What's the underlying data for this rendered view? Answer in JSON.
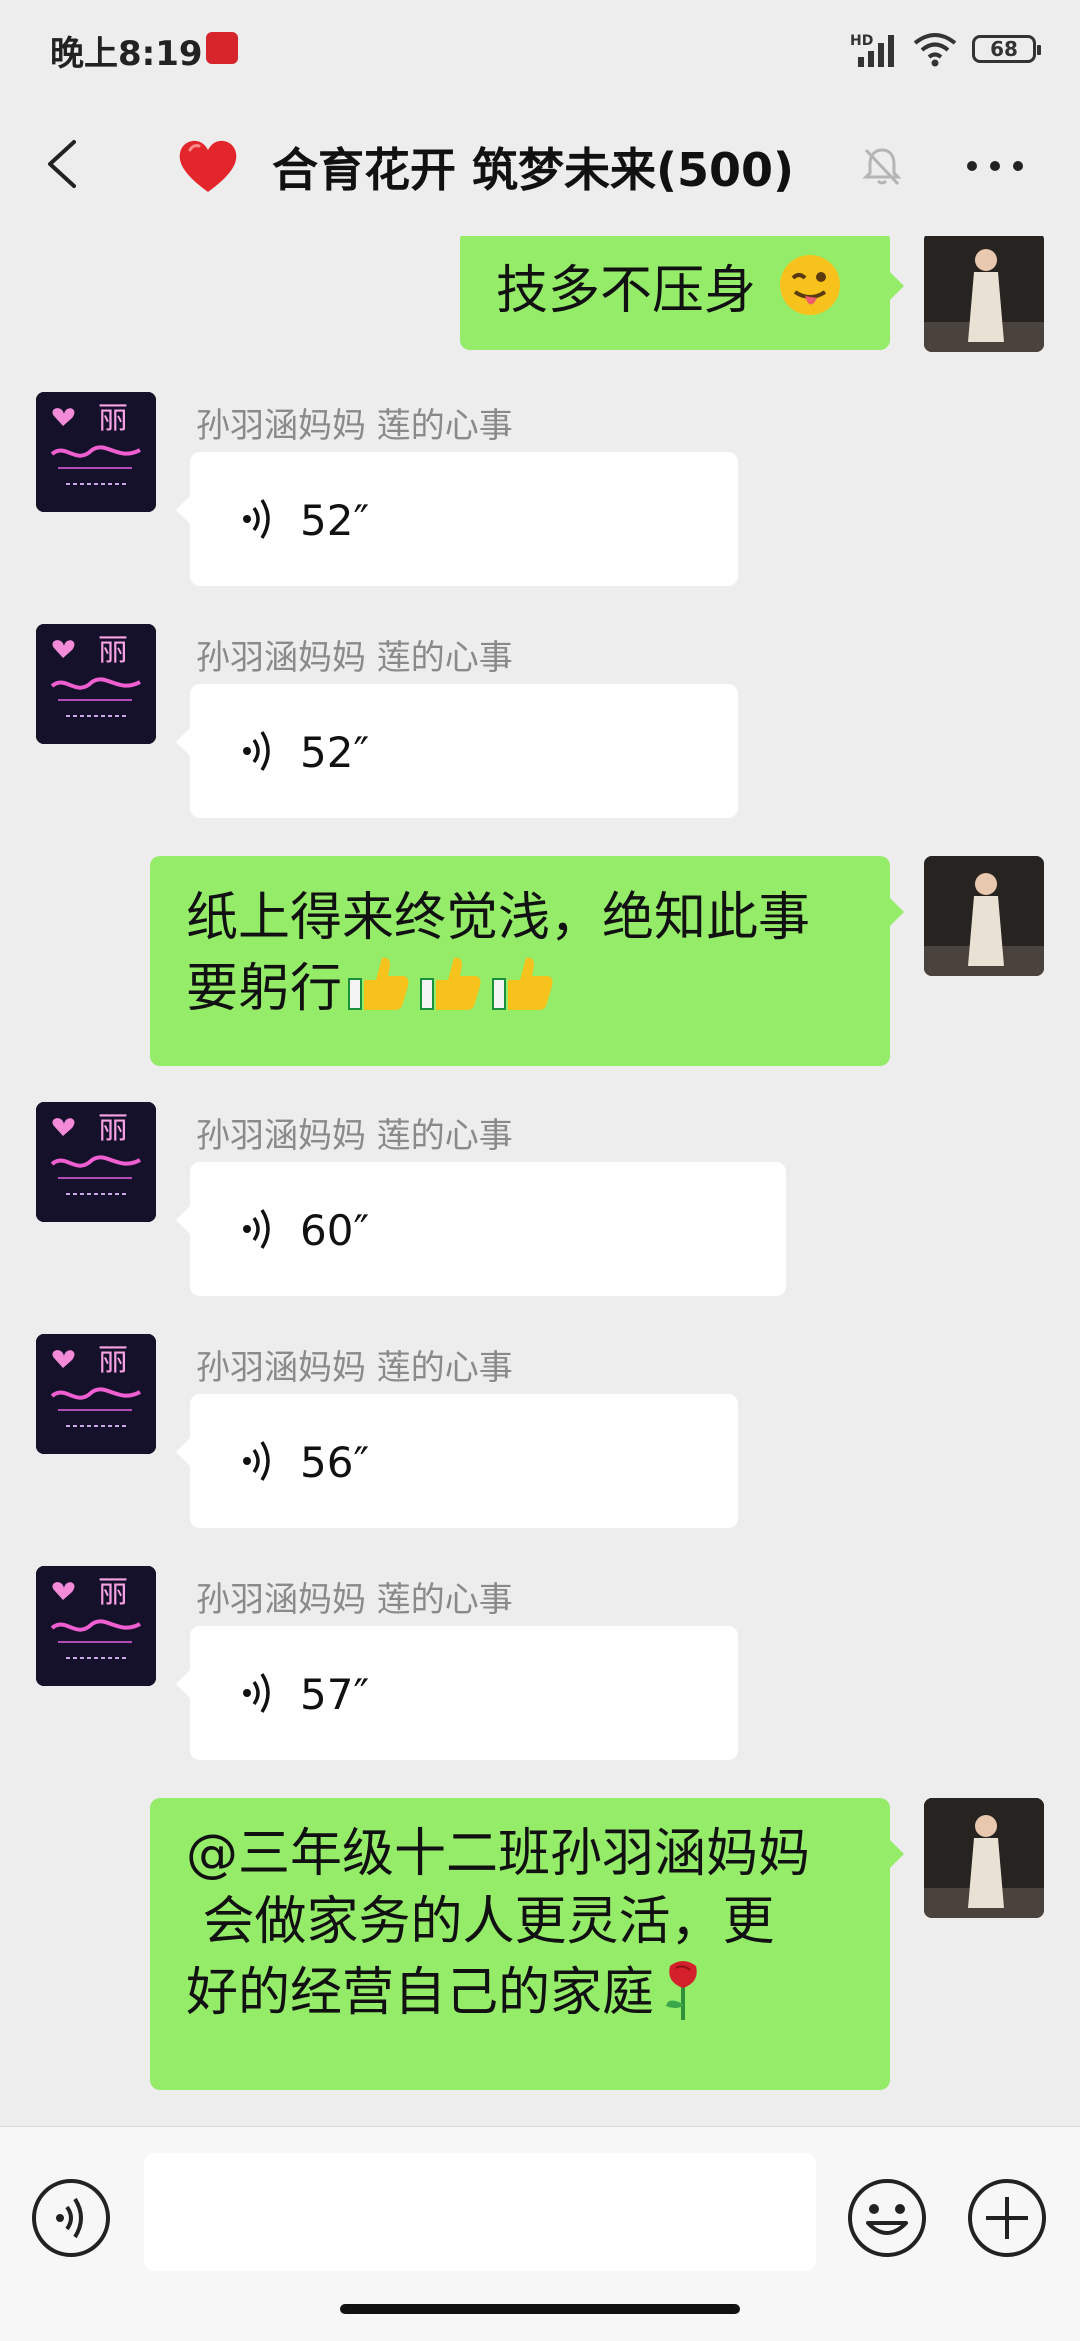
{
  "status_bar": {
    "time": "晚上8:19",
    "network_label": "HD",
    "battery_level": "68"
  },
  "header": {
    "title": "合育花开 筑梦未来(500)",
    "icons": {
      "back": "chevron-left-icon",
      "group_emblem": "heart-icon",
      "mute": "muted-bell-icon",
      "more": "more-dots-icon"
    }
  },
  "messages": [
    {
      "type": "text",
      "direction": "outgoing",
      "lines": [
        "技多不压身"
      ],
      "trailing_emoji": "wink-tongue-emoji"
    },
    {
      "type": "voice",
      "direction": "incoming",
      "sender": "孙羽涵妈妈  莲的心事",
      "duration": "52″"
    },
    {
      "type": "voice",
      "direction": "incoming",
      "sender": "孙羽涵妈妈  莲的心事",
      "duration": "52″"
    },
    {
      "type": "text",
      "direction": "outgoing",
      "lines": [
        "纸上得来终觉浅，绝知此事",
        "要躬行"
      ],
      "trailing_emoji": "thumbs-up-emoji ×3"
    },
    {
      "type": "voice",
      "direction": "incoming",
      "sender": "孙羽涵妈妈  莲的心事",
      "duration": "60″"
    },
    {
      "type": "voice",
      "direction": "incoming",
      "sender": "孙羽涵妈妈  莲的心事",
      "duration": "56″"
    },
    {
      "type": "voice",
      "direction": "incoming",
      "sender": "孙羽涵妈妈  莲的心事",
      "duration": "57″"
    },
    {
      "type": "text",
      "direction": "outgoing",
      "lines": [
        "@三年级十二班孙羽涵妈妈",
        " 会做家务的人更灵活，更",
        "好的经营自己的家庭"
      ],
      "trailing_emoji": "rose-emoji"
    }
  ],
  "input_bar": {
    "placeholder": "",
    "icons": {
      "voice": "voice-input-icon",
      "emoji": "emoji-icon",
      "plus": "plus-icon"
    }
  },
  "colors": {
    "background": "#ededed",
    "outgoing_bubble": "#95ec69",
    "incoming_bubble": "#ffffff",
    "sender_name": "#8a8a8a"
  }
}
